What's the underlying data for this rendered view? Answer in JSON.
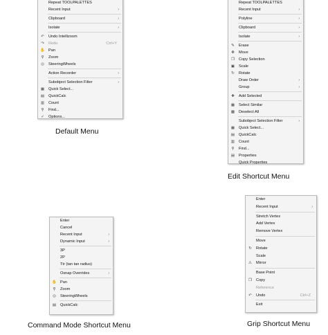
{
  "default_menu": {
    "caption": "Default Menu",
    "items": [
      {
        "label": "Repeat TOOLPALETTES"
      },
      {
        "label": "Recent Input",
        "arrow": true
      },
      {
        "sep": true
      },
      {
        "label": "Clipboard",
        "arrow": true
      },
      {
        "sep": true
      },
      {
        "label": "Isolate",
        "arrow": true
      },
      {
        "sep": true
      },
      {
        "label": "Undo Intellizoom",
        "icon": "undo-icon",
        "glyph": "↶"
      },
      {
        "label": "Redo",
        "shortcut": "Ctrl+Y",
        "disabled": true,
        "icon": "redo-icon",
        "glyph": "↷"
      },
      {
        "label": "Pan",
        "icon": "pan-hand-icon",
        "glyph": "✋"
      },
      {
        "label": "Zoom",
        "icon": "zoom-icon",
        "glyph": "⚲"
      },
      {
        "label": "SteeringWheels",
        "icon": "steering-wheel-icon",
        "glyph": "◎"
      },
      {
        "sep": true
      },
      {
        "label": "Action Recorder",
        "arrow": true
      },
      {
        "sep": true
      },
      {
        "label": "Subobject Selection Filter",
        "arrow": true
      },
      {
        "label": "Quick Select...",
        "icon": "quick-select-icon",
        "glyph": "▦"
      },
      {
        "label": "QuickCalc",
        "icon": "calculator-icon",
        "glyph": "▤"
      },
      {
        "label": "Count",
        "icon": "count-icon",
        "glyph": "▥"
      },
      {
        "label": "Find...",
        "icon": "find-icon",
        "glyph": "⚲"
      },
      {
        "label": "Options...",
        "icon": "options-icon",
        "glyph": "✓"
      }
    ]
  },
  "edit_menu": {
    "caption": "Edit Shortcut Menu",
    "items": [
      {
        "label": "Repeat TOOLPALETTES"
      },
      {
        "label": "Recent Input",
        "arrow": true
      },
      {
        "sep": true
      },
      {
        "label": "Polyline",
        "arrow": true
      },
      {
        "sep": true
      },
      {
        "label": "Clipboard",
        "arrow": true
      },
      {
        "sep": true
      },
      {
        "label": "Isolate",
        "arrow": true
      },
      {
        "sep": true
      },
      {
        "label": "Erase",
        "icon": "erase-icon",
        "glyph": "✎"
      },
      {
        "label": "Move",
        "icon": "move-icon",
        "glyph": "✥"
      },
      {
        "label": "Copy Selection",
        "icon": "copy-icon",
        "glyph": "❐"
      },
      {
        "label": "Scale",
        "icon": "scale-icon",
        "glyph": "▣"
      },
      {
        "label": "Rotate",
        "icon": "rotate-icon",
        "glyph": "↻"
      },
      {
        "label": "Draw Order",
        "arrow": true
      },
      {
        "label": "Group",
        "arrow": true
      },
      {
        "sep": true
      },
      {
        "label": "Add Selected",
        "icon": "add-selected-icon",
        "glyph": "✚"
      },
      {
        "sep": true
      },
      {
        "label": "Select Similar",
        "icon": "select-similar-icon",
        "glyph": "▦"
      },
      {
        "label": "Deselect All",
        "icon": "deselect-icon",
        "glyph": "▩"
      },
      {
        "sep": true
      },
      {
        "label": "Subobject Selection Filter",
        "arrow": true
      },
      {
        "label": "Quick Select...",
        "icon": "quick-select-icon",
        "glyph": "▦"
      },
      {
        "label": "QuickCalc",
        "icon": "calculator-icon",
        "glyph": "▤"
      },
      {
        "label": "Count",
        "icon": "count-icon",
        "glyph": "▥"
      },
      {
        "label": "Find...",
        "icon": "find-icon",
        "glyph": "⚲"
      },
      {
        "label": "Properties",
        "icon": "properties-icon",
        "glyph": "▤"
      },
      {
        "label": "Quick Properties"
      }
    ]
  },
  "command_menu": {
    "caption": "Command Mode Shortcut Menu",
    "items": [
      {
        "label": "Enter"
      },
      {
        "label": "Cancel"
      },
      {
        "label": "Recent Input",
        "arrow": true
      },
      {
        "label": "Dynamic Input",
        "arrow": true
      },
      {
        "sep": true
      },
      {
        "label": "3P"
      },
      {
        "label": "2P"
      },
      {
        "label": "Ttr (tan tan radius)"
      },
      {
        "sep": true
      },
      {
        "label": "Osnap Overrides",
        "arrow": true
      },
      {
        "sep": true
      },
      {
        "label": "Pan",
        "icon": "pan-hand-icon",
        "glyph": "✋"
      },
      {
        "label": "Zoom",
        "icon": "zoom-icon",
        "glyph": "⚲"
      },
      {
        "label": "SteeringWheels",
        "icon": "steering-wheel-icon",
        "glyph": "◎"
      },
      {
        "sep": true
      },
      {
        "label": "QuickCalc",
        "icon": "calculator-icon",
        "glyph": "▤"
      }
    ]
  },
  "grip_menu": {
    "caption": "Grip Shortcut Menu",
    "items": [
      {
        "label": "Enter"
      },
      {
        "label": "Recent Input",
        "arrow": true
      },
      {
        "sep": true
      },
      {
        "label": "Stretch Vertex"
      },
      {
        "label": "Add Vertex"
      },
      {
        "label": "Remove Vertex"
      },
      {
        "sep": true
      },
      {
        "label": "Move"
      },
      {
        "label": "Rotate",
        "icon": "rotate-icon",
        "glyph": "↻"
      },
      {
        "label": "Scale"
      },
      {
        "label": "Mirror",
        "icon": "mirror-icon",
        "glyph": "⚠"
      },
      {
        "sep": true
      },
      {
        "label": "Base Point"
      },
      {
        "label": "Copy",
        "icon": "copy-icon",
        "glyph": "❐"
      },
      {
        "label": "Reference",
        "disabled": true
      },
      {
        "label": "Undo",
        "shortcut": "Ctrl+Z",
        "icon": "undo-icon",
        "glyph": "↶"
      },
      {
        "sep": true
      },
      {
        "label": "Exit"
      }
    ]
  }
}
